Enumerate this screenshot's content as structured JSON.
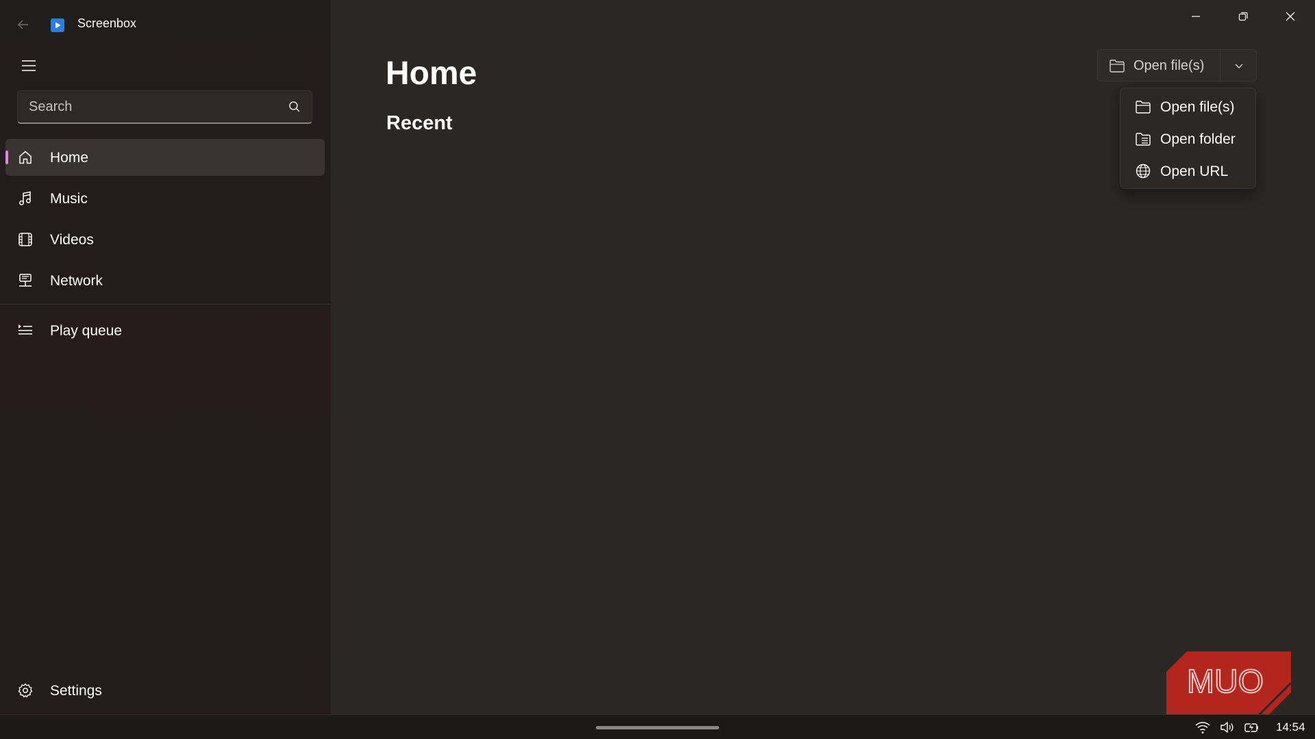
{
  "app": {
    "title": "Screenbox",
    "logo_color": "#2a7de1",
    "back_icon": "arrow-left-icon",
    "menu_icon": "hamburger-icon"
  },
  "search": {
    "placeholder": "Search",
    "value": "",
    "icon": "search-icon"
  },
  "sidebar": {
    "items": [
      {
        "label": "Home",
        "icon": "home-icon",
        "selected": true
      },
      {
        "label": "Music",
        "icon": "music-note-icon",
        "selected": false
      },
      {
        "label": "Videos",
        "icon": "film-icon",
        "selected": false
      },
      {
        "label": "Network",
        "icon": "network-icon",
        "selected": false
      }
    ],
    "play_queue": {
      "label": "Play queue",
      "icon": "queue-icon"
    },
    "settings": {
      "label": "Settings",
      "icon": "gear-icon"
    },
    "selection_accent": "#d88be0"
  },
  "main": {
    "page_title": "Home",
    "section_title": "Recent"
  },
  "open_button": {
    "label": "Open file(s)",
    "icon": "folder-icon",
    "dropdown_icon": "chevron-down-icon"
  },
  "open_menu": {
    "items": [
      {
        "label": "Open file(s)",
        "icon": "folder-icon"
      },
      {
        "label": "Open folder",
        "icon": "folder-list-icon"
      },
      {
        "label": "Open URL",
        "icon": "globe-icon"
      }
    ]
  },
  "window_controls": {
    "minimize_icon": "minimize-icon",
    "restore_icon": "restore-icon",
    "close_icon": "close-icon"
  },
  "watermark": {
    "text": "MUO",
    "color": "#b3261e"
  },
  "taskbar": {
    "clock": "14:54",
    "tray_icons": [
      "wifi-icon",
      "volume-icon",
      "battery-charging-icon"
    ]
  }
}
